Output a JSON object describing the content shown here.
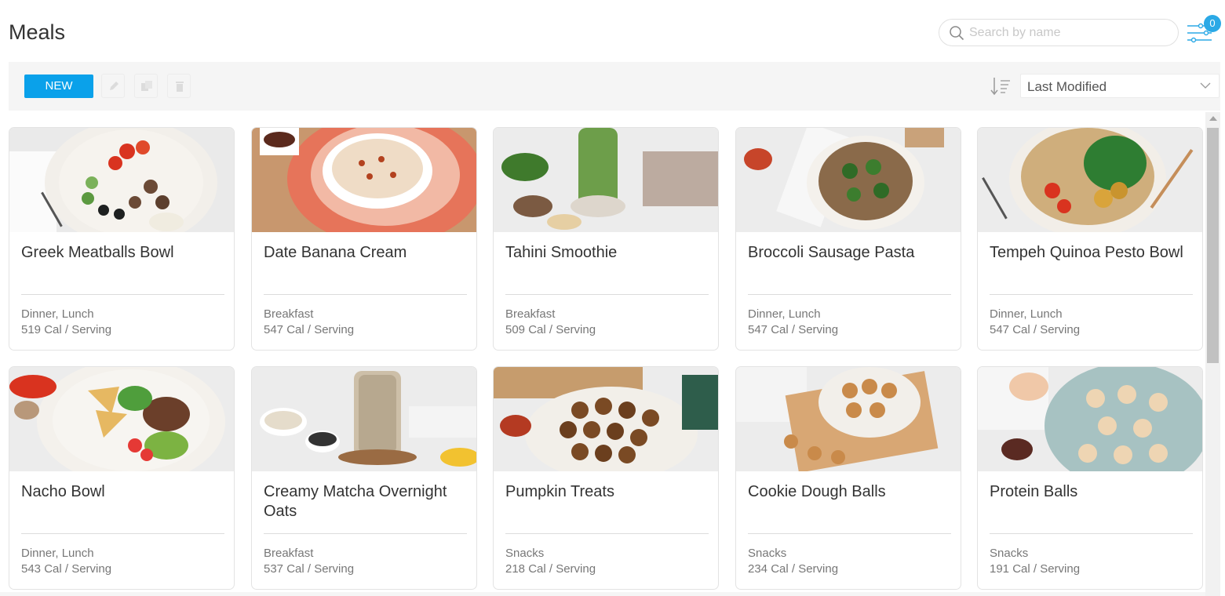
{
  "header": {
    "title": "Meals",
    "search_placeholder": "Search by name",
    "filter_count": "0"
  },
  "toolbar": {
    "new_label": "NEW",
    "sort_value": "Last Modified"
  },
  "meals": [
    {
      "name": "Greek Meatballs Bowl",
      "category": "Dinner, Lunch",
      "calories": "519 Cal / Serving",
      "image": "bowl-meatballs-photo"
    },
    {
      "name": "Date Banana Cream",
      "category": "Breakfast",
      "calories": "547 Cal / Serving",
      "image": "date-cream-photo"
    },
    {
      "name": "Tahini Smoothie",
      "category": "Breakfast",
      "calories": "509 Cal / Serving",
      "image": "green-smoothie-photo"
    },
    {
      "name": "Broccoli Sausage Pasta",
      "category": "Dinner, Lunch",
      "calories": "547 Cal / Serving",
      "image": "pasta-photo"
    },
    {
      "name": "Tempeh Quinoa Pesto Bowl",
      "category": "Dinner, Lunch",
      "calories": "547 Cal / Serving",
      "image": "quinoa-bowl-photo"
    },
    {
      "name": "Nacho Bowl",
      "category": "Dinner, Lunch",
      "calories": "543 Cal / Serving",
      "image": "nacho-bowl-photo"
    },
    {
      "name": "Creamy Matcha Overnight Oats",
      "category": "Breakfast",
      "calories": "537 Cal / Serving",
      "image": "oats-jar-photo"
    },
    {
      "name": "Pumpkin Treats",
      "category": "Snacks",
      "calories": "218 Cal / Serving",
      "image": "pumpkin-balls-photo"
    },
    {
      "name": "Cookie Dough Balls",
      "category": "Snacks",
      "calories": "234 Cal / Serving",
      "image": "cookie-dough-photo"
    },
    {
      "name": "Protein Balls",
      "category": "Snacks",
      "calories": "191 Cal / Serving",
      "image": "protein-balls-photo"
    }
  ],
  "colors": {
    "accent": "#0aa1ea",
    "badge": "#2ba9e6",
    "toolbar_bg": "#f5f5f5"
  }
}
